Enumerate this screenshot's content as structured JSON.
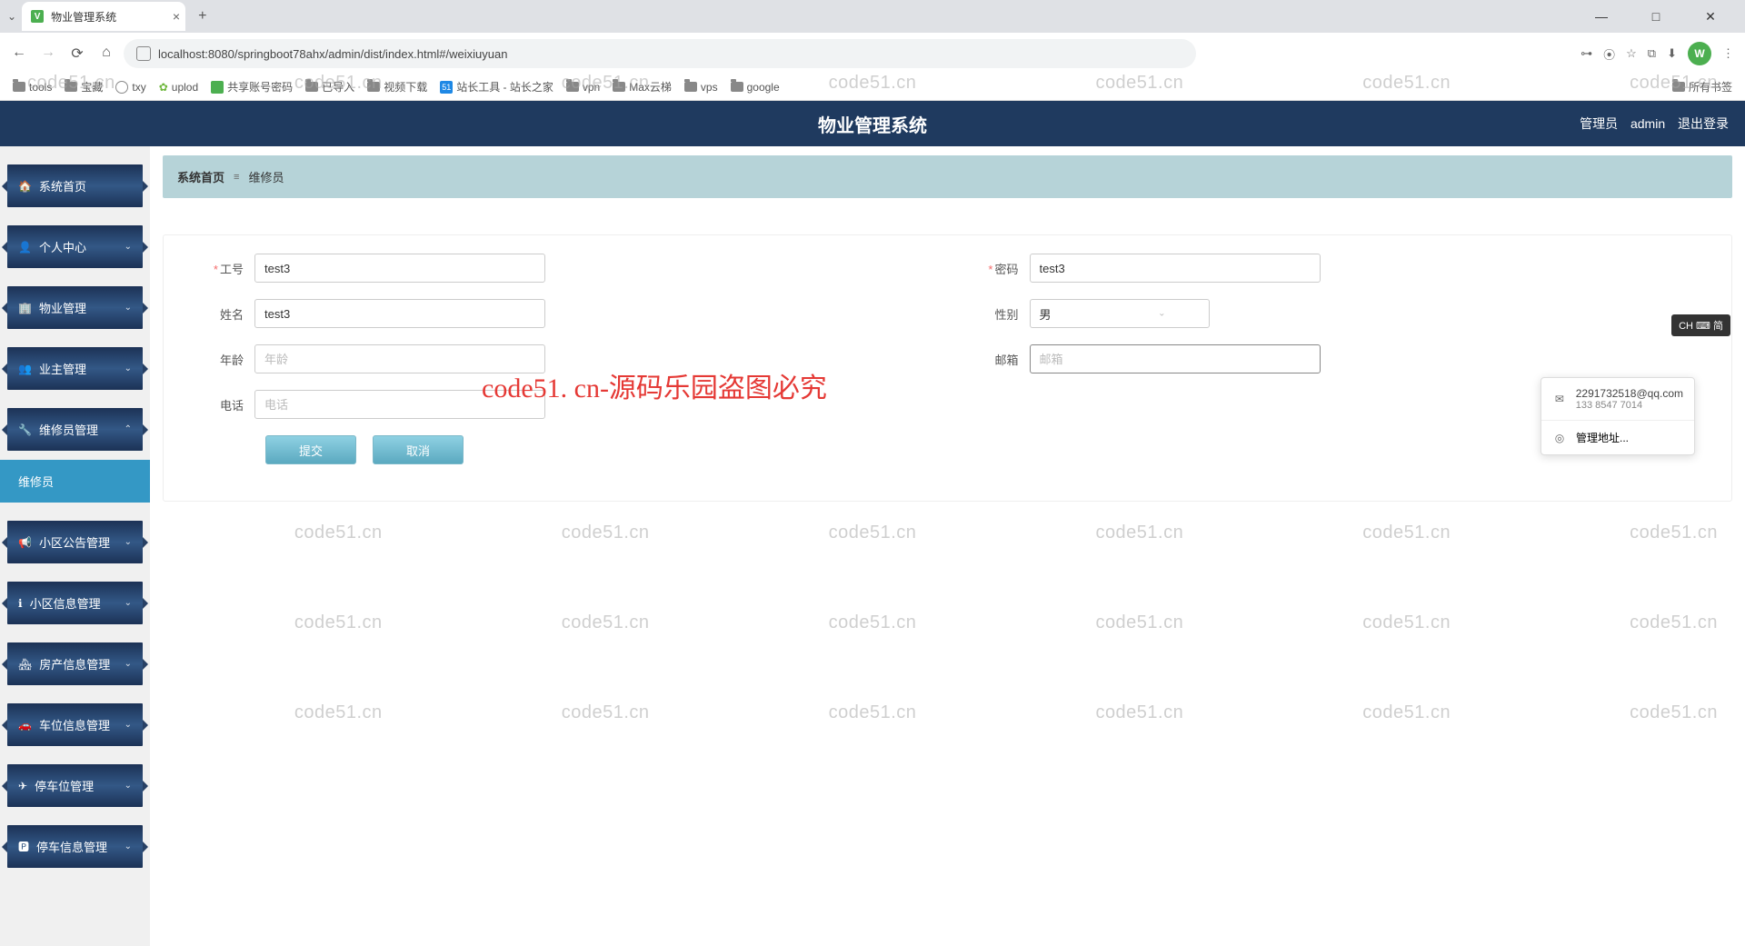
{
  "browser": {
    "tab_title": "物业管理系统",
    "url": "localhost:8080/springboot78ahx/admin/dist/index.html#/weixiuyuan",
    "bookmarks": [
      "tools",
      "宝藏",
      "txy",
      "uplod",
      "共享账号密码",
      "已导入",
      "视频下载",
      "站长工具 - 站长之家",
      "vpn",
      "Max云梯",
      "vps",
      "google"
    ],
    "bookmark_right": "所有书签",
    "avatar_letter": "W"
  },
  "watermark": "code51.cn",
  "red_watermark": "code51. cn-源码乐园盗图必究",
  "header": {
    "title": "物业管理系统",
    "user_prefix": "管理员",
    "user": "admin",
    "logout": "退出登录"
  },
  "sidebar": {
    "items": [
      {
        "icon": "🏠",
        "label": "系统首页",
        "expandable": false
      },
      {
        "icon": "👤",
        "label": "个人中心",
        "expandable": true
      },
      {
        "icon": "🏢",
        "label": "物业管理",
        "expandable": true
      },
      {
        "icon": "👥",
        "label": "业主管理",
        "expandable": true
      },
      {
        "icon": "🔧",
        "label": "维修员管理",
        "expandable": true,
        "sub": "维修员"
      },
      {
        "icon": "📢",
        "label": "小区公告管理",
        "expandable": true
      },
      {
        "icon": "ℹ",
        "label": "小区信息管理",
        "expandable": true
      },
      {
        "icon": "🏘",
        "label": "房产信息管理",
        "expandable": true
      },
      {
        "icon": "🚗",
        "label": "车位信息管理",
        "expandable": true
      },
      {
        "icon": "✈",
        "label": "停车位管理",
        "expandable": true
      },
      {
        "icon": "🅿",
        "label": "停车信息管理",
        "expandable": true
      }
    ]
  },
  "breadcrumb": {
    "home": "系统首页",
    "sep": "≡",
    "current": "维修员"
  },
  "form": {
    "labels": {
      "gonghao": "工号",
      "mima": "密码",
      "xingming": "姓名",
      "xingbie": "性别",
      "nianling": "年龄",
      "youxiang": "邮箱",
      "dianhua": "电话"
    },
    "values": {
      "gonghao": "test3",
      "mima": "test3",
      "xingming": "test3",
      "xingbie": "男"
    },
    "placeholders": {
      "nianling": "年龄",
      "youxiang": "邮箱",
      "dianhua": "电话"
    },
    "buttons": {
      "submit": "提交",
      "cancel": "取消"
    }
  },
  "autofill": {
    "email": "2291732518@qq.com",
    "phone": "133 8547 7014",
    "manage": "管理地址..."
  },
  "ime": "CH ⌨ 简"
}
